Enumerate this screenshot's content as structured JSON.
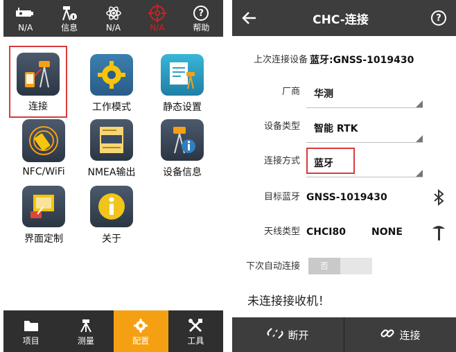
{
  "left": {
    "status": [
      {
        "icon": "battery-icon",
        "label": "N/A"
      },
      {
        "icon": "satellite-dish-icon",
        "label": "信息"
      },
      {
        "icon": "atom-icon",
        "label": "N/A"
      },
      {
        "icon": "crosshair-icon",
        "label": "N/A",
        "alert": true
      },
      {
        "icon": "help-icon",
        "glyph": "?",
        "label": "帮助"
      }
    ],
    "tiles": [
      {
        "label": "连接",
        "icon": "connection-icon",
        "color": "#f5a012",
        "selected": true
      },
      {
        "label": "工作模式",
        "icon": "work-mode-gear-icon",
        "color": "#29a8d6"
      },
      {
        "label": "静态设置",
        "icon": "static-settings-icon",
        "color": "#2cb3d2"
      },
      {
        "label": "NFC/WiFi",
        "icon": "nfc-wifi-icon",
        "color": "#f5a012"
      },
      {
        "label": "NMEA输出",
        "icon": "nmea-output-icon",
        "color": "#f0b323",
        "badge": "NMEA"
      },
      {
        "label": "设备信息",
        "icon": "device-info-icon",
        "color": "#f5a012"
      },
      {
        "label": "界面定制",
        "icon": "ui-customize-icon",
        "color": "#f5a012"
      },
      {
        "label": "关于",
        "icon": "about-icon",
        "color": "#f0c419"
      }
    ],
    "nav": [
      {
        "label": "项目",
        "icon": "folder-icon"
      },
      {
        "label": "测量",
        "icon": "survey-icon"
      },
      {
        "label": "配置",
        "icon": "config-gear-icon",
        "active": true
      },
      {
        "label": "工具",
        "icon": "tools-icon"
      }
    ]
  },
  "right": {
    "title": "CHC-连接",
    "help_glyph": "?",
    "last_device_label": "上次连接设备",
    "last_device_value": "蓝牙:GNSS-1019430",
    "manufacturer_label": "厂商",
    "manufacturer_value": "华测",
    "device_type_label": "设备类型",
    "device_type_value": "智能 RTK",
    "connect_mode_label": "连接方式",
    "connect_mode_value": "蓝牙",
    "target_bt_label": "目标蓝牙",
    "target_bt_value": "GNSS-1019430",
    "antenna_label": "天线类型",
    "antenna_value_1": "CHCI80",
    "antenna_value_2": "NONE",
    "auto_connect_label": "下次自动连接",
    "auto_connect_value": "否",
    "status_message": "未连接接收机！",
    "disconnect_label": "断开",
    "connect_label": "连接"
  }
}
